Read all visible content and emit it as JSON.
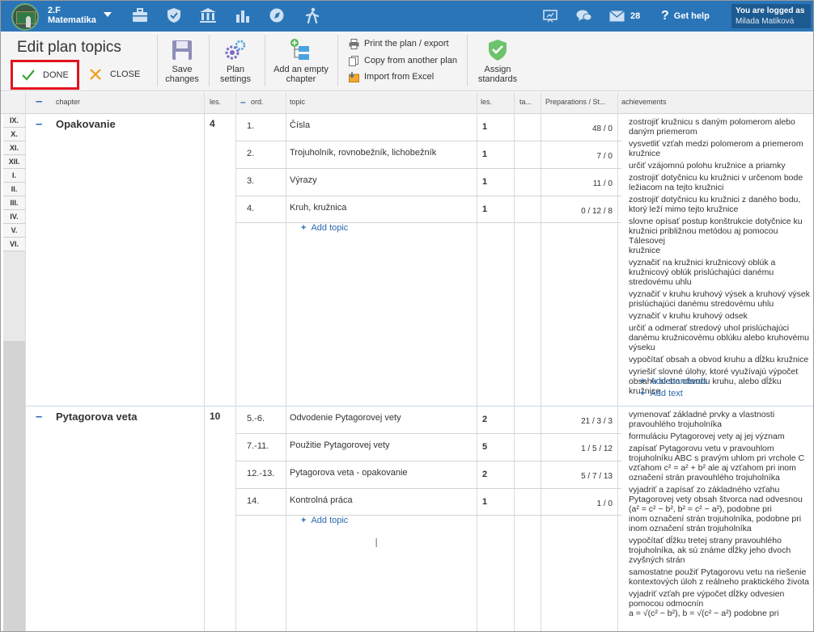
{
  "topbar": {
    "class_code": "2.F",
    "class_subject": "Matematika",
    "messages_count": "28",
    "help_label": "Get help",
    "login_label": "You are logged as",
    "user_name": "Milada Matiková",
    "bg_color": "#2a75b8"
  },
  "toolbar": {
    "title": "Edit plan topics",
    "done_label": "DONE",
    "close_label": "CLOSE",
    "save_label_1": "Save",
    "save_label_2": "changes",
    "plan_settings_1": "Plan",
    "plan_settings_2": "settings",
    "add_chapter_1": "Add an empty",
    "add_chapter_2": "chapter",
    "print_label": "Print the plan / export",
    "copy_label": "Copy from another plan",
    "import_label": "Import from Excel",
    "assign_1": "Assign",
    "assign_2": "standards"
  },
  "table": {
    "headers": {
      "chapter": "chapter",
      "les": "les.",
      "ord": "ord.",
      "topic": "topic",
      "les2": "les.",
      "ta": "ta...",
      "prep": "Preparations / St...",
      "achv": "achievements"
    },
    "months": [
      "IX.",
      "X.",
      "XI.",
      "XII.",
      "I.",
      "II.",
      "III.",
      "IV.",
      "V.",
      "VI."
    ]
  },
  "chapters": [
    {
      "name": "Opakovanie",
      "lessons": "4",
      "add_topic": "Add topic",
      "topics": [
        {
          "ord": "1.",
          "name": "Čísla",
          "les": "1",
          "prep": "48 / 0"
        },
        {
          "ord": "2.",
          "name": "Trojuholník, rovnobežník, lichobežník",
          "les": "1",
          "prep": "7 / 0"
        },
        {
          "ord": "3.",
          "name": "Výrazy",
          "les": "1",
          "prep": "11 / 0"
        },
        {
          "ord": "4.",
          "name": "Kruh, kružnica",
          "les": "1",
          "prep": "0 / 12 / 8"
        }
      ],
      "achievements": [
        "zostrojiť kružnicu s daným polomerom alebo\ndaným priemerom",
        "vysvetliť vzťah medzi polomerom a priemerom\nkružnice",
        "určiť vzájomnú polohu kružnice a priamky",
        "zostrojiť dotyčnicu ku kružnici v určenom bode\nležiacom na tejto kružnici",
        "zostrojiť dotyčnicu ku kružnici z daného bodu,\nktorý leží mimo tejto kružnice",
        "slovne opísať postup konštrukcie dotyčnice ku\nkružnici približnou metódou aj pomocou Tálesovej\nkružnice",
        "vyznačiť na kružnici kružnicový oblúk a\nkružnicový oblúk prislúchajúci danému\nstredovému uhlu",
        "vyznačiť v kruhu kruhový výsek a kruhový výsek\nprislúchajúci danému stredovému uhlu",
        "vyznačiť v kruhu kruhový odsek",
        "určiť a odmerať stredový uhol prislúchajúci\ndanému kružnicovému oblúku alebo kruhovému\nvýseku",
        "vypočítať obsah a obvod kruhu a dĺžku kružnice",
        "vyriešiť slovné úlohy, ktoré využívajú výpočet\nobsahu alebo obvodu kruhu, alebo dĺžku kružnice"
      ],
      "add_standards": "Add standards",
      "add_text": "Add text"
    },
    {
      "name": "Pytagorova veta",
      "lessons": "10",
      "add_topic": "Add topic",
      "topics": [
        {
          "ord": "5.-6.",
          "name": "Odvodenie Pytagorovej vety",
          "les": "2",
          "prep": "21 / 3 / 3"
        },
        {
          "ord": "7.-11.",
          "name": "Použitie Pytagorovej vety",
          "les": "5",
          "prep": "1 / 5 / 12"
        },
        {
          "ord": "12.-13.",
          "name": "Pytagorova veta - opakovanie",
          "les": "2",
          "prep": "5 / 7 / 13"
        },
        {
          "ord": "14.",
          "name": "Kontrolná práca",
          "les": "1",
          "prep": "1 / 0"
        }
      ],
      "achievements": [
        "vymenovať základné prvky a vlastnosti\npravouhlého trojuholníka",
        "formuláciu Pytagorovej vety aj jej význam",
        "zapísať Pytagorovu vetu v pravouhlom\ntrojuholníku ABC s pravým uhlom pri vrchole C\nvzťahom c² = a² + b² ale aj vzťahom pri inom\noznačení strán pravouhlého trojuholníka",
        "vyjadriť a zapísať zo základného vzťahu\nPytagorovej vety obsah štvorca nad odvesnou\n(a² = c² − b², b² = c² − a²), podobne pri\ninom označení strán trojuholníka, podobne pri\ninom označení strán trojuholníka",
        "vypočítať dĺžku tretej strany pravouhlého\ntrojuholníka, ak sú známe dĺžky jeho dvoch\nzvyšných strán",
        "samostatne použiť Pytagorovu vetu na riešenie\nkontextových úloh z reálneho praktického života",
        "vyjadriť vzťah pre výpočet dĺžky odvesien\npomocou odmocnín\na = √(c² − b²), b = √(c² − a²) podobne pri"
      ]
    }
  ]
}
